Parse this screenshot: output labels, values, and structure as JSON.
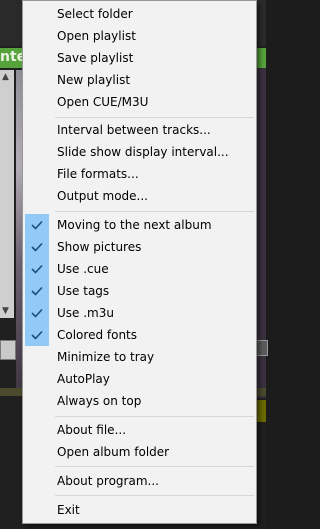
{
  "background": {
    "partial_label": "nte"
  },
  "menu": {
    "items": [
      {
        "label": "Select folder",
        "checked": false
      },
      {
        "label": "Open playlist",
        "checked": false
      },
      {
        "label": "Save playlist",
        "checked": false
      },
      {
        "label": "New playlist",
        "checked": false
      },
      {
        "label": "Open CUE/M3U",
        "checked": false
      },
      {
        "label": "Interval between tracks...",
        "checked": false
      },
      {
        "label": "Slide show display interval...",
        "checked": false
      },
      {
        "label": "File formats...",
        "checked": false
      },
      {
        "label": "Output mode...",
        "checked": false
      },
      {
        "label": "Moving to the next album",
        "checked": true
      },
      {
        "label": "Show pictures",
        "checked": true
      },
      {
        "label": "Use .cue",
        "checked": true
      },
      {
        "label": "Use tags",
        "checked": true
      },
      {
        "label": "Use .m3u",
        "checked": true
      },
      {
        "label": "Colored fonts",
        "checked": true
      },
      {
        "label": "Minimize to tray",
        "checked": false
      },
      {
        "label": "AutoPlay",
        "checked": false
      },
      {
        "label": "Always on top",
        "checked": false
      },
      {
        "label": "About file...",
        "checked": false
      },
      {
        "label": "Open album folder",
        "checked": false
      },
      {
        "label": "About program...",
        "checked": false
      },
      {
        "label": "Exit",
        "checked": false
      }
    ]
  },
  "colors": {
    "check_bg": "#91c9f7",
    "check_mark": "#1d4f7a",
    "menu_bg": "#f2f2f2"
  }
}
